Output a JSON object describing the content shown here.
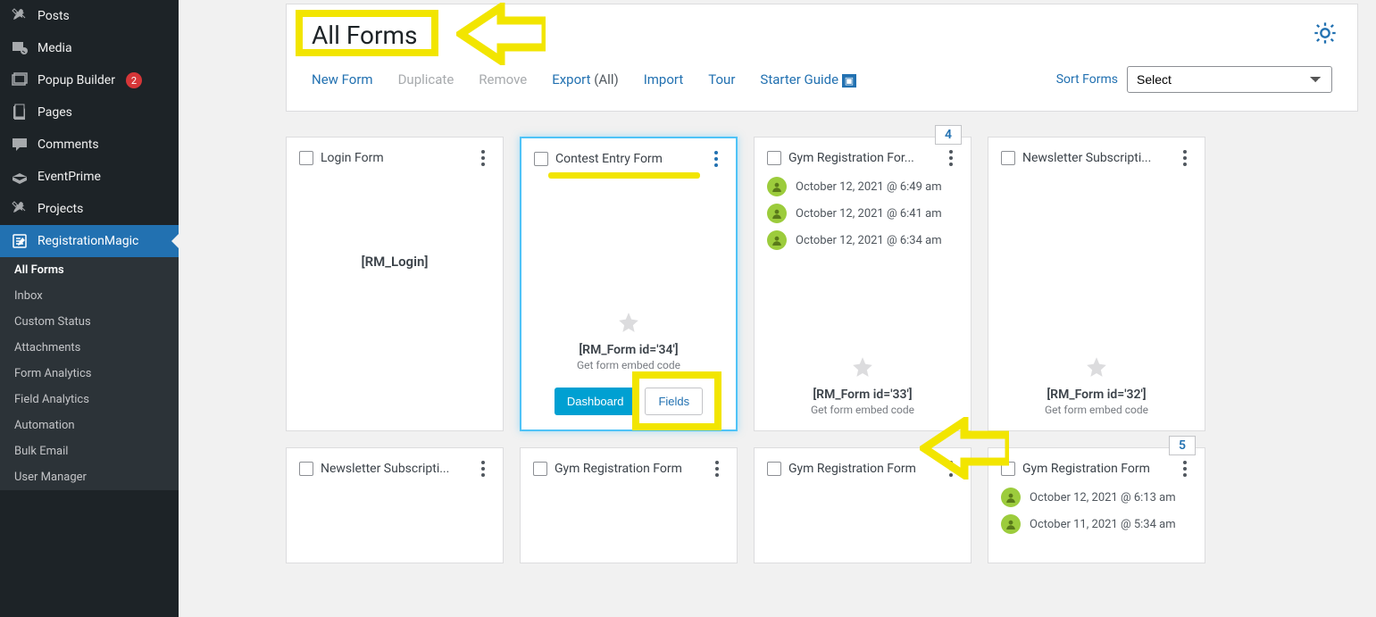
{
  "sidebar": {
    "items": [
      {
        "label": "Posts",
        "icon": "pin"
      },
      {
        "label": "Media",
        "icon": "media"
      },
      {
        "label": "Popup Builder",
        "icon": "popup",
        "badge": "2"
      },
      {
        "label": "Pages",
        "icon": "page"
      },
      {
        "label": "Comments",
        "icon": "comment"
      },
      {
        "label": "EventPrime",
        "icon": "event"
      },
      {
        "label": "Projects",
        "icon": "pin"
      },
      {
        "label": "RegistrationMagic",
        "icon": "form",
        "active": true
      }
    ],
    "sub": [
      {
        "label": "All Forms",
        "current": true
      },
      {
        "label": "Inbox"
      },
      {
        "label": "Custom Status"
      },
      {
        "label": "Attachments"
      },
      {
        "label": "Form Analytics"
      },
      {
        "label": "Field Analytics"
      },
      {
        "label": "Automation"
      },
      {
        "label": "Bulk Email"
      },
      {
        "label": "User Manager"
      }
    ]
  },
  "page_title": "All Forms",
  "toolbar": {
    "new_form": "New Form",
    "duplicate": "Duplicate",
    "remove": "Remove",
    "export": "Export",
    "export_suffix": "(All)",
    "import": "Import",
    "tour": "Tour",
    "starter": "Starter Guide"
  },
  "sort": {
    "label": "Sort Forms",
    "selected": "Select"
  },
  "cards": [
    {
      "title": "Login Form",
      "type": "login",
      "shortcode": "[RM_Login]"
    },
    {
      "title": "Contest Entry Form",
      "type": "form",
      "shortcode": "[RM_Form id='34']",
      "embed": "Get form embed code",
      "highlight": true,
      "actions": {
        "dashboard": "Dashboard",
        "fields": "Fields"
      }
    },
    {
      "title": "Gym Registration For...",
      "type": "form",
      "shortcode": "[RM_Form id='33']",
      "embed": "Get form embed code",
      "count": "4",
      "entries": [
        "October 12, 2021 @ 6:49 am",
        "October 12, 2021 @ 6:41 am",
        "October 12, 2021 @ 6:34 am"
      ]
    },
    {
      "title": "Newsletter Subscripti...",
      "type": "form",
      "shortcode": "[RM_Form id='32']",
      "embed": "Get form embed code"
    },
    {
      "title": "Newsletter Subscripti...",
      "type": "form2"
    },
    {
      "title": "Gym Registration Form",
      "type": "form2"
    },
    {
      "title": "Gym Registration Form",
      "type": "form2"
    },
    {
      "title": "Gym Registration Form",
      "type": "form2",
      "count": "5",
      "entries": [
        "October 12, 2021 @ 6:13 am",
        "October 11, 2021 @ 5:34 am"
      ]
    }
  ]
}
